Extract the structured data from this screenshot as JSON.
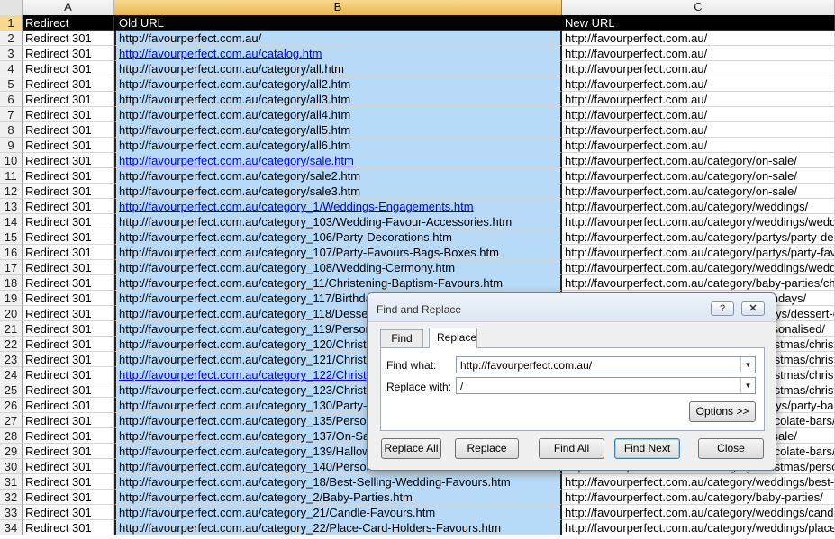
{
  "columns": {
    "a": "A",
    "b": "B",
    "c": "C"
  },
  "rows": [
    {
      "n": "1",
      "a": "Redirect",
      "b": "Old URL",
      "c": "New URL",
      "header": true
    },
    {
      "n": "2",
      "a": "Redirect 301",
      "b": "http://favourperfect.com.au/",
      "c": "http://favourperfect.com.au/"
    },
    {
      "n": "3",
      "a": "Redirect 301",
      "b": "http://favourperfect.com.au/catalog.htm",
      "c": "http://favourperfect.com.au/",
      "link": true
    },
    {
      "n": "4",
      "a": "Redirect 301",
      "b": "http://favourperfect.com.au/category/all.htm",
      "c": "http://favourperfect.com.au/"
    },
    {
      "n": "5",
      "a": "Redirect 301",
      "b": "http://favourperfect.com.au/category/all2.htm",
      "c": "http://favourperfect.com.au/"
    },
    {
      "n": "6",
      "a": "Redirect 301",
      "b": "http://favourperfect.com.au/category/all3.htm",
      "c": "http://favourperfect.com.au/"
    },
    {
      "n": "7",
      "a": "Redirect 301",
      "b": "http://favourperfect.com.au/category/all4.htm",
      "c": "http://favourperfect.com.au/"
    },
    {
      "n": "8",
      "a": "Redirect 301",
      "b": "http://favourperfect.com.au/category/all5.htm",
      "c": "http://favourperfect.com.au/"
    },
    {
      "n": "9",
      "a": "Redirect 301",
      "b": "http://favourperfect.com.au/category/all6.htm",
      "c": "http://favourperfect.com.au/"
    },
    {
      "n": "10",
      "a": "Redirect 301",
      "b": "http://favourperfect.com.au/category/sale.htm",
      "c": "http://favourperfect.com.au/category/on-sale/",
      "link": true
    },
    {
      "n": "11",
      "a": "Redirect 301",
      "b": "http://favourperfect.com.au/category/sale2.htm",
      "c": "http://favourperfect.com.au/category/on-sale/"
    },
    {
      "n": "12",
      "a": "Redirect 301",
      "b": "http://favourperfect.com.au/category/sale3.htm",
      "c": "http://favourperfect.com.au/category/on-sale/"
    },
    {
      "n": "13",
      "a": "Redirect 301",
      "b": "http://favourperfect.com.au/category_1/Weddings-Engagements.htm",
      "c": "http://favourperfect.com.au/category/weddings/",
      "link": true
    },
    {
      "n": "14",
      "a": "Redirect 301",
      "b": "http://favourperfect.com.au/category_103/Wedding-Favour-Accessories.htm",
      "c": "http://favourperfect.com.au/category/weddings/weddi"
    },
    {
      "n": "15",
      "a": "Redirect 301",
      "b": "http://favourperfect.com.au/category_106/Party-Decorations.htm",
      "c": "http://favourperfect.com.au/category/partys/party-de"
    },
    {
      "n": "16",
      "a": "Redirect 301",
      "b": "http://favourperfect.com.au/category_107/Party-Favours-Bags-Boxes.htm",
      "c": "http://favourperfect.com.au/category/partys/party-fav"
    },
    {
      "n": "17",
      "a": "Redirect 301",
      "b": "http://favourperfect.com.au/category_108/Wedding-Cermony.htm",
      "c": "http://favourperfect.com.au/category/weddings/weddi"
    },
    {
      "n": "18",
      "a": "Redirect 301",
      "b": "http://favourperfect.com.au/category_11/Christening-Baptism-Favours.htm",
      "c": "http://favourperfect.com.au/category/baby-parties/chr"
    },
    {
      "n": "19",
      "a": "Redirect 301",
      "b": "http://favourperfect.com.au/category_117/Birthday",
      "c": "http://favourperfect.com.au/category/birthdays/"
    },
    {
      "n": "20",
      "a": "Redirect 301",
      "b": "http://favourperfect.com.au/category_118/Desse",
      "c": "http://favourperfect.com.au/category/partys/dessert-c"
    },
    {
      "n": "21",
      "a": "Redirect 301",
      "b": "http://favourperfect.com.au/category_119/Person",
      "c": "http://favourperfect.com.au/category/personalised/"
    },
    {
      "n": "22",
      "a": "Redirect 301",
      "b": "http://favourperfect.com.au/category_120/Christ",
      "c": "http://favourperfect.com.au/category/christmas/christ"
    },
    {
      "n": "23",
      "a": "Redirect 301",
      "b": "http://favourperfect.com.au/category_121/Christ",
      "c": "http://favourperfect.com.au/category/christmas/christ"
    },
    {
      "n": "24",
      "a": "Redirect 301",
      "b": "http://favourperfect.com.au/category_122/Christ",
      "c": "http://favourperfect.com.au/category/christmas/christ",
      "link": true
    },
    {
      "n": "25",
      "a": "Redirect 301",
      "b": "http://favourperfect.com.au/category_123/Christ",
      "c": "http://favourperfect.com.au/category/christmas/christ"
    },
    {
      "n": "26",
      "a": "Redirect 301",
      "b": "http://favourperfect.com.au/category_130/Party-",
      "c": "http://favourperfect.com.au/category/partys/party-bal"
    },
    {
      "n": "27",
      "a": "Redirect 301",
      "b": "http://favourperfect.com.au/category_135/Person",
      "c": "http://favourperfect.com.au/category/chocolate-bars/"
    },
    {
      "n": "28",
      "a": "Redirect 301",
      "b": "http://favourperfect.com.au/category_137/On-Sa",
      "c": "http://favourperfect.com.au/category/on-sale/"
    },
    {
      "n": "29",
      "a": "Redirect 301",
      "b": "http://favourperfect.com.au/category_139/Hallow",
      "c": "http://favourperfect.com.au/category/chocolate-bars/"
    },
    {
      "n": "30",
      "a": "Redirect 301",
      "b": "http://favourperfect.com.au/category_140/Person",
      "c": "http://favourperfect.com.au/category/christmas/perso"
    },
    {
      "n": "31",
      "a": "Redirect 301",
      "b": "http://favourperfect.com.au/category_18/Best-Selling-Wedding-Favours.htm",
      "c": "http://favourperfect.com.au/category/weddings/best-s"
    },
    {
      "n": "32",
      "a": "Redirect 301",
      "b": "http://favourperfect.com.au/category_2/Baby-Parties.htm",
      "c": "http://favourperfect.com.au/category/baby-parties/"
    },
    {
      "n": "33",
      "a": "Redirect 301",
      "b": "http://favourperfect.com.au/category_21/Candle-Favours.htm",
      "c": "http://favourperfect.com.au/category/weddings/candl"
    },
    {
      "n": "34",
      "a": "Redirect 301",
      "b": "http://favourperfect.com.au/category_22/Place-Card-Holders-Favours.htm",
      "c": "http://favourperfect.com.au/category/weddings/place"
    }
  ],
  "dialog": {
    "title": "Find and Replace",
    "help_label": "?",
    "close_label": "✕",
    "tab_find": "Find",
    "tab_replace": "Replace",
    "find_what_label": "Find what:",
    "find_what_value": "http://favourperfect.com.au/",
    "replace_with_label": "Replace with:",
    "replace_with_value": "/",
    "options_label": "Options >>",
    "replace_all_label": "Replace All",
    "replace_label": "Replace",
    "find_all_label": "Find All",
    "find_next_label": "Find Next",
    "close_button_label": "Close",
    "dropdown_icon": "chevron-down-icon"
  },
  "colors": {
    "selection": "#b6daf8",
    "link": "#0000ee",
    "header_bg": "#000000",
    "selected_column_header": "#e8b64c"
  }
}
